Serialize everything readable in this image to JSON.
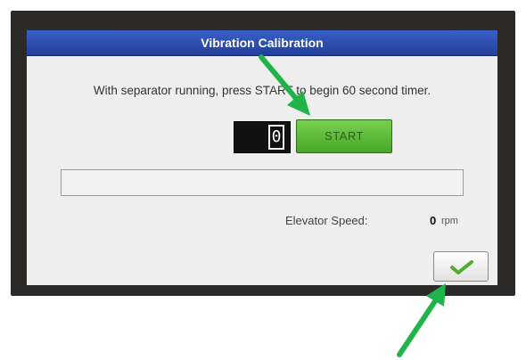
{
  "window": {
    "title": "Vibration Calibration"
  },
  "instruction": "With separator running, press START to begin 60 second timer.",
  "timer": {
    "value": "0"
  },
  "start_button": {
    "label": "START"
  },
  "progress": {
    "fraction": 0.0
  },
  "elevator_speed": {
    "label": "Elevator Speed:",
    "value": "0",
    "unit": "rpm"
  },
  "confirm_button": {
    "icon": "checkmark-icon"
  },
  "colors": {
    "title_bar": "#2d51b5",
    "start_button": "#5fbd3a",
    "annotation_arrow": "#1fb34a",
    "checkmark": "#4fae2f"
  }
}
